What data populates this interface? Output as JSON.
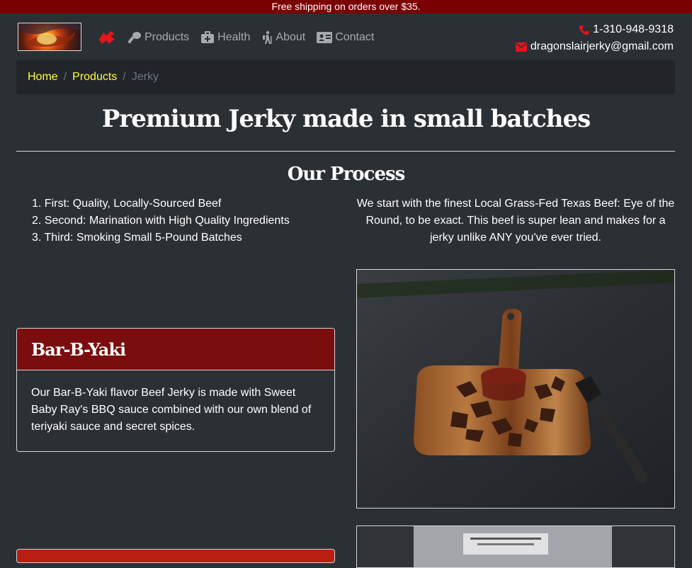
{
  "topbar": {
    "text": "Free shipping on orders over $35."
  },
  "nav": {
    "items": [
      {
        "label": "Products",
        "icon": "drumstick-icon"
      },
      {
        "label": "Health",
        "icon": "medkit-icon"
      },
      {
        "label": "About",
        "icon": "hiking-icon"
      },
      {
        "label": "Contact",
        "icon": "id-card-icon"
      }
    ]
  },
  "contact": {
    "phone": "1-310-948-9318",
    "email": "dragonslairjerky@gmail.com"
  },
  "breadcrumb": {
    "home": "Home",
    "products": "Products",
    "current": "Jerky",
    "separator": "/"
  },
  "page": {
    "title": "Premium Jerky made in small batches",
    "section_title": "Our Process"
  },
  "process": {
    "steps": [
      "1. First: Quality, Locally-Sourced Beef",
      "2. Second: Marination with High Quality Ingredients",
      "3. Third: Smoking Small 5-Pound Batches"
    ],
    "description": "We start with the finest Local Grass-Fed Texas Beef: Eye of the Round, to be exact. This beef is super lean and makes for a jerky unlike ANY you've ever tried."
  },
  "products": [
    {
      "name": "Bar-B-Yaki",
      "description": "Our Bar-B-Yaki flavor Beef Jerky is made with Sweet Baby Ray's BBQ sauce combined with our own blend of teriyaki sauce and secret spices."
    }
  ],
  "colors": {
    "topbar": "#7b0000",
    "background": "#2b3035",
    "breadcrumb_link": "#ffff33",
    "card_header": "#7a0d0d",
    "accent_red": "#e3161b"
  }
}
